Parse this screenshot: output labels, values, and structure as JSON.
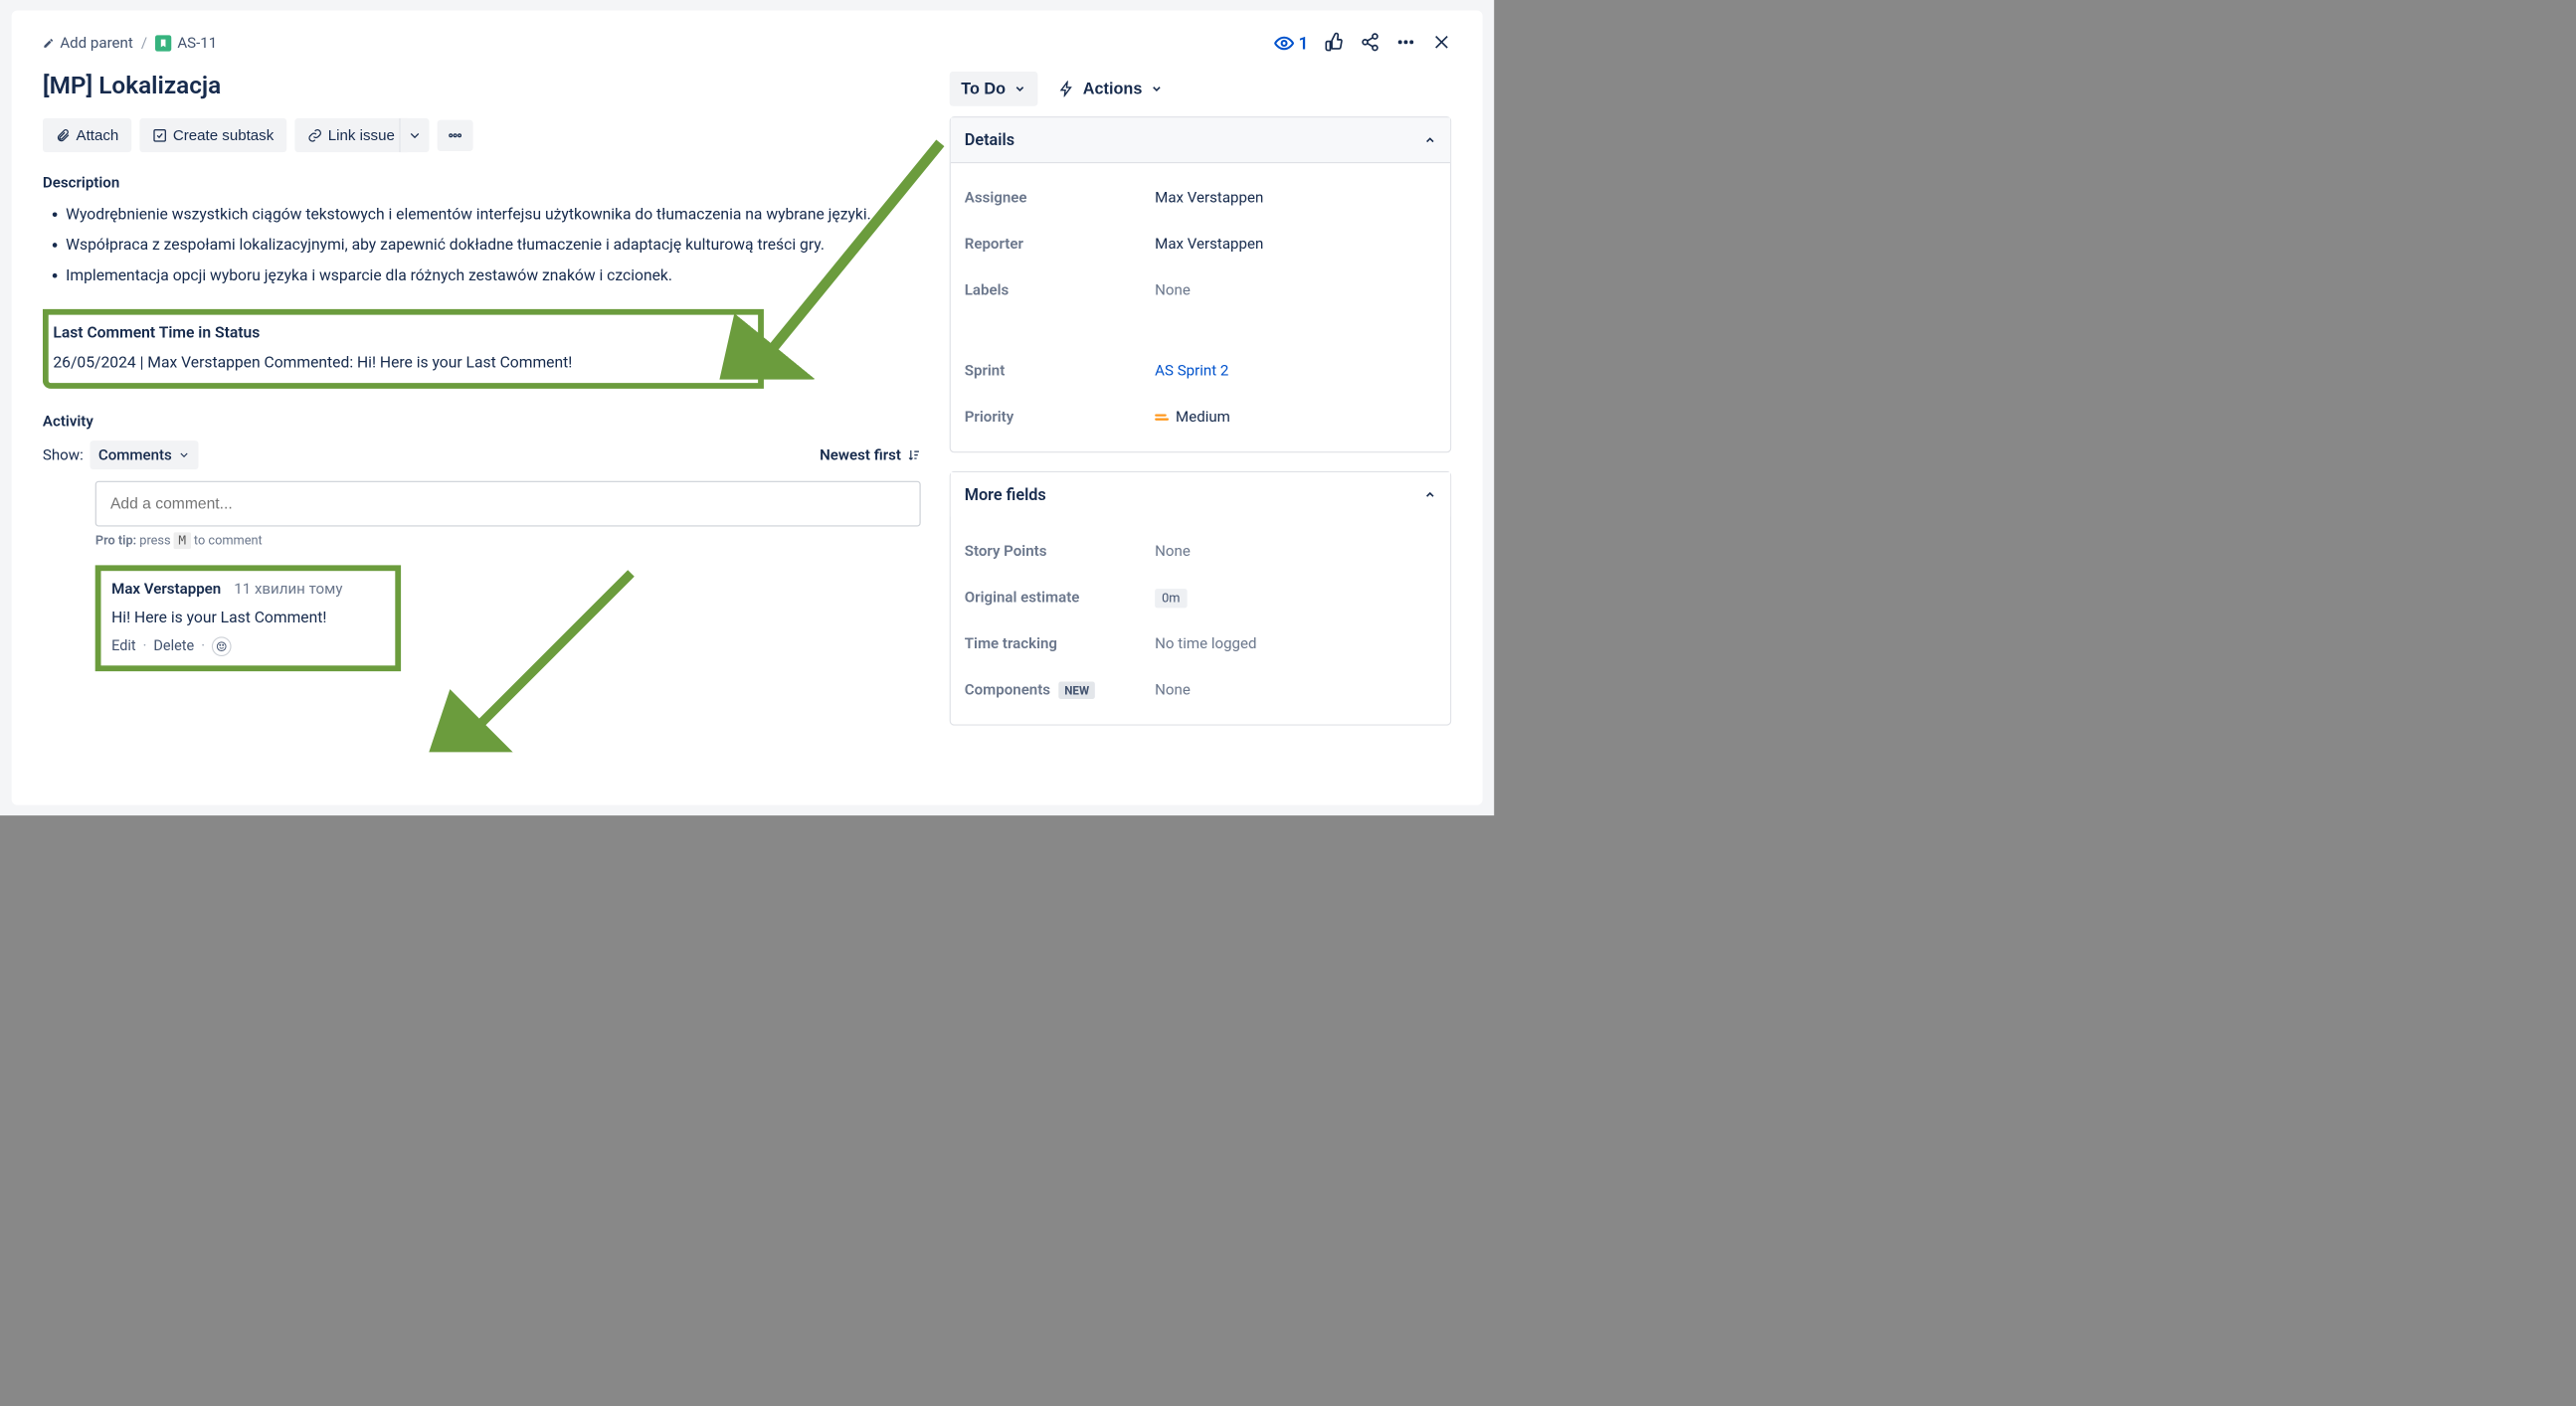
{
  "breadcrumb": {
    "add_parent": "Add parent",
    "issue_key": "AS-11"
  },
  "top": {
    "watch_count": "1"
  },
  "issue": {
    "title": "[MP] Lokalizacja"
  },
  "buttons": {
    "attach": "Attach",
    "create_subtask": "Create subtask",
    "link_issue": "Link issue"
  },
  "description": {
    "label": "Description",
    "items": [
      "Wyodrębnienie wszystkich ciągów tekstowych i elementów interfejsu użytkownika do tłumaczenia na wybrane języki.",
      "Współpraca z zespołami lokalizacyjnymi, aby zapewnić dokładne tłumaczenie i adaptację kulturową treści gry.",
      "Implementacja opcji wyboru języka i wsparcie dla różnych zestawów znaków i czcionek."
    ]
  },
  "last_comment_box": {
    "title": "Last Comment Time in Status",
    "text": "26/05/2024 | Max Verstappen Commented: Hi! Here is your Last Comment!"
  },
  "activity": {
    "label": "Activity",
    "show_label": "Show:",
    "filter": "Comments",
    "sort": "Newest first",
    "comment_placeholder": "Add a comment...",
    "protip_prefix": "Pro tip:",
    "protip_press": " press ",
    "protip_key": "M",
    "protip_suffix": " to comment"
  },
  "comment": {
    "author": "Max Verstappen",
    "time": "11 хвилин тому",
    "body": "Hi! Here is your Last Comment!",
    "edit": "Edit",
    "delete": "Delete"
  },
  "status": {
    "value": "To Do",
    "actions_label": "Actions"
  },
  "details": {
    "header": "Details",
    "fields": {
      "assignee_label": "Assignee",
      "assignee_value": "Max Verstappen",
      "reporter_label": "Reporter",
      "reporter_value": "Max Verstappen",
      "labels_label": "Labels",
      "labels_value": "None",
      "sprint_label": "Sprint",
      "sprint_value": "AS Sprint 2",
      "priority_label": "Priority",
      "priority_value": "Medium"
    }
  },
  "more_fields": {
    "header": "More fields",
    "fields": {
      "story_points_label": "Story Points",
      "story_points_value": "None",
      "original_estimate_label": "Original estimate",
      "original_estimate_value": "0m",
      "time_tracking_label": "Time tracking",
      "time_tracking_value": "No time logged",
      "components_label": "Components",
      "components_badge": "NEW",
      "components_value": "None"
    }
  }
}
